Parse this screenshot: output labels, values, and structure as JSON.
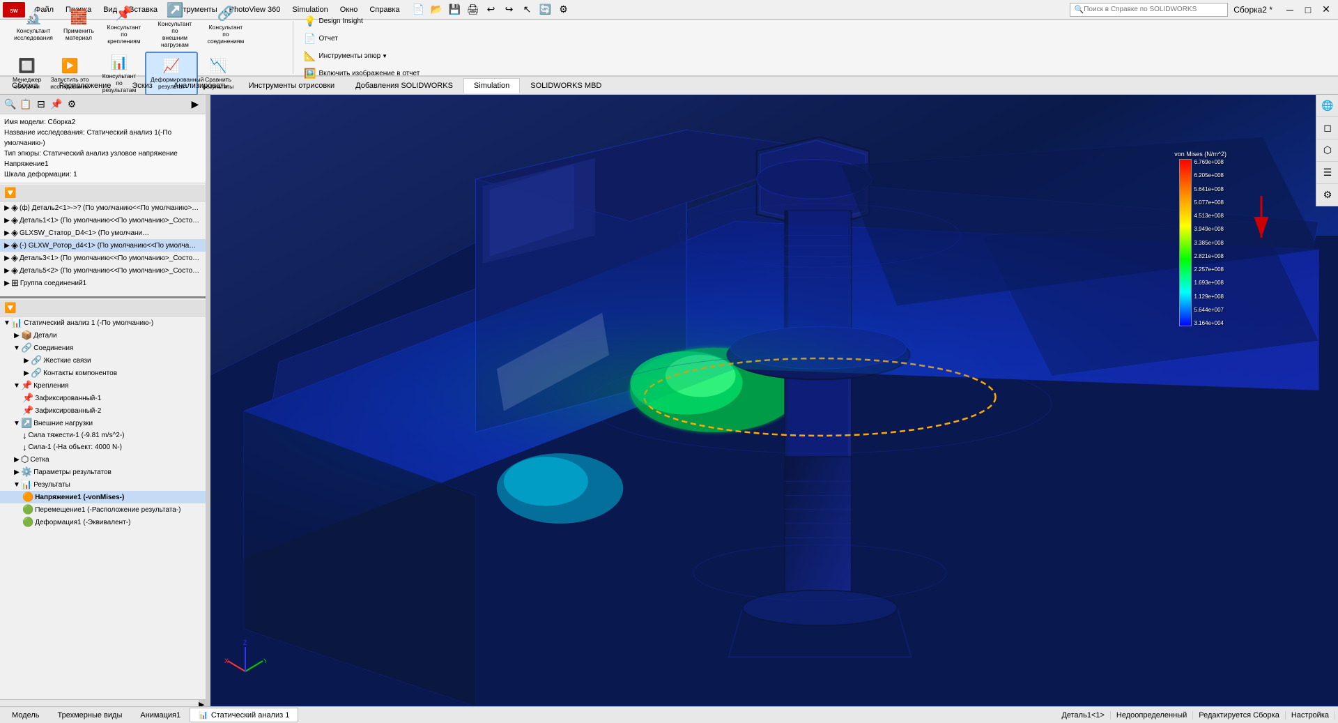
{
  "app": {
    "title": "Сборка2 *",
    "logo": "SW",
    "window_state": "maximized"
  },
  "title_bar": {
    "menus": [
      "Файл",
      "Правка",
      "Вид",
      "Вставка",
      "Инструменты",
      "PhotoView 360",
      "Simulation",
      "Окно",
      "Справка"
    ],
    "search_placeholder": "Поиск в Справке по SOLIDWORKS",
    "title": "Сборка2 *"
  },
  "toolbar": {
    "groups": [
      {
        "buttons": [
          {
            "label": "Консультант\nисследования",
            "icon": "🔬"
          },
          {
            "label": "Применить\nматериал",
            "icon": "🧱"
          },
          {
            "label": "Консультант по\nкреплениям",
            "icon": "📌"
          },
          {
            "label": "Консультант по\nвнешним нагрузкам",
            "icon": "↗"
          },
          {
            "label": "Консультант по\nсоединениям",
            "icon": "🔗"
          },
          {
            "label": "Менеджер\nоболочки",
            "icon": "🔲"
          },
          {
            "label": "Запустить это\nисследование",
            "icon": "▶"
          },
          {
            "label": "Консультант по\nрезультатам",
            "icon": "📊"
          },
          {
            "label": "Деформированный\nрезультат",
            "icon": "📈",
            "active": true
          },
          {
            "label": "Сравнить\nрезультаты",
            "icon": "📉"
          }
        ]
      },
      {
        "buttons": [
          {
            "label": "Design Insight",
            "icon": "💡"
          },
          {
            "label": "Отчет",
            "icon": "📄"
          },
          {
            "label": "Инструменты эпюр",
            "icon": "📐"
          },
          {
            "label": "Включить изображение в отчет",
            "icon": "🖼"
          }
        ]
      }
    ]
  },
  "tabs": {
    "items": [
      "Сборка",
      "Расположение",
      "Эскиз",
      "Анализировать",
      "Инструменты отрисовки",
      "Добавления SOLIDWORKS",
      "Simulation",
      "SOLIDWORKS MBD"
    ],
    "active": "Simulation"
  },
  "info_panel": {
    "model_name": "Имя модели: Сборка2",
    "study_name": "Название исследования: Статический анализ 1(-По умолчанию-)",
    "plot_type": "Тип эпюры: Статический анализ узловое напряжение Напряжение1",
    "deform_scale": "Шкала деформации: 1"
  },
  "tree": {
    "top_items": [
      {
        "label": "(ф) Деталь2<1>->? (По умолчанию<<По умолчанию>…",
        "icon": "◈",
        "indent": 0,
        "expanded": false
      },
      {
        "label": "Деталь1<1> (По умолчанию<<По умолчанию>_Сосо…",
        "icon": "◈",
        "indent": 0,
        "expanded": false
      },
      {
        "label": "GLXSW_Статор_D4<1> (По умолчани…",
        "icon": "◈",
        "indent": 0,
        "expanded": false
      },
      {
        "label": "(-) GLXW_Ротор_d4<1> (По умолчанию<<По умолча…",
        "icon": "◈",
        "indent": 0,
        "expanded": false
      },
      {
        "label": "Деталь3<1> (По умолчанию<<По умолчанию>_Сосо…",
        "icon": "◈",
        "indent": 0,
        "expanded": false
      },
      {
        "label": "Деталь5<2> (По умолчанию<<По умолчанию>_Сосо…",
        "icon": "◈",
        "indent": 0,
        "expanded": false
      },
      {
        "label": "Группа соединений1",
        "icon": "⊞",
        "indent": 0,
        "expanded": false
      }
    ],
    "simulation_items": [
      {
        "label": "Статический анализ 1 (-По умолчанию-)",
        "icon": "📊",
        "indent": 0,
        "expanded": true
      },
      {
        "label": "Детали",
        "icon": "📦",
        "indent": 1,
        "expanded": false
      },
      {
        "label": "Соединения",
        "icon": "🔗",
        "indent": 1,
        "expanded": true
      },
      {
        "label": "Жесткие связи",
        "icon": "🔗",
        "indent": 2,
        "expanded": false
      },
      {
        "label": "Контакты компонентов",
        "icon": "🔗",
        "indent": 2,
        "expanded": false
      },
      {
        "label": "Крепления",
        "icon": "📌",
        "indent": 1,
        "expanded": true
      },
      {
        "label": "Зафиксированный-1",
        "icon": "📌",
        "indent": 2,
        "expanded": false
      },
      {
        "label": "Зафиксированный-2",
        "icon": "📌",
        "indent": 2,
        "expanded": false
      },
      {
        "label": "Внешние нагрузки",
        "icon": "↗",
        "indent": 1,
        "expanded": true
      },
      {
        "label": "Сила тяжести-1 (-9.81 m/s^2-)",
        "icon": "↓",
        "indent": 2,
        "expanded": false
      },
      {
        "label": "Сила-1 (-На объект: 4000 N-)",
        "icon": "↓",
        "indent": 2,
        "expanded": false
      },
      {
        "label": "Сетка",
        "icon": "⬡",
        "indent": 1,
        "expanded": false
      },
      {
        "label": "Параметры результатов",
        "icon": "⚙",
        "indent": 1,
        "expanded": false
      },
      {
        "label": "Результаты",
        "icon": "📊",
        "indent": 1,
        "expanded": true
      },
      {
        "label": "Напряжение1 (-vonMises-)",
        "icon": "🟠",
        "indent": 2,
        "expanded": false,
        "selected": true
      },
      {
        "label": "Перемещение1 (-Расположение результата-)",
        "icon": "🟢",
        "indent": 2,
        "expanded": false
      },
      {
        "label": "Деформация1 (-Эквивалент-)",
        "icon": "🟢",
        "indent": 2,
        "expanded": false
      }
    ]
  },
  "color_legend": {
    "title": "von Mises (N/m^2)",
    "max_value": "6.769e+008",
    "values": [
      "6.769e+008",
      "6.205e+008",
      "5.641e+008",
      "5.077e+008",
      "4.513e+008",
      "3.949e+008",
      "3.385e+008",
      "2.821e+008",
      "2.257e+008",
      "1.693e+008",
      "1.129e+008",
      "5.644e+007",
      "3.164e+004"
    ]
  },
  "status_bar": {
    "part_name": "Деталь1<1>",
    "underdefined": "Недоопределенный",
    "editing": "Редактируется Сборка",
    "settings": "Настройка"
  },
  "bottom_tabs": {
    "items": [
      "Модель",
      "Трехмерные виды",
      "Анимация1",
      "Статический анализ 1"
    ],
    "active": "Статический анализ 1"
  },
  "viewport_toolbar": {
    "icons": [
      "🔍",
      "🔄",
      "📐",
      "🎯",
      "💡",
      "📷",
      "🔲",
      "⬜",
      "◻",
      "🌐"
    ]
  },
  "right_icons": [
    "🌐",
    "◻",
    "🔲",
    "☰",
    "⬡"
  ]
}
